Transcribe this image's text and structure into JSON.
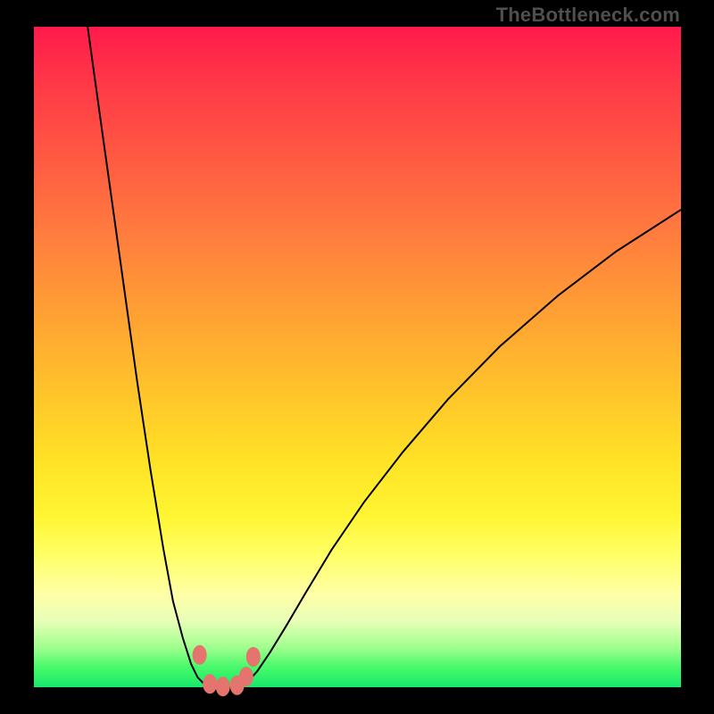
{
  "attribution": "TheBottleneck.com",
  "colors": {
    "top": "#ff1a4b",
    "mid": "#ffe326",
    "bottom": "#17e86a",
    "curve": "#000000",
    "markers": "#e4746d",
    "frame": "#000000"
  },
  "chart_data": {
    "type": "line",
    "title": "",
    "xlabel": "",
    "ylabel": "",
    "xlim": [
      0,
      100
    ],
    "ylim": [
      0,
      100
    ],
    "annotations": [],
    "series": [
      {
        "name": "left-branch",
        "x": [
          8.3,
          10,
          12,
          14,
          16,
          18,
          20,
          21.5,
          23,
          24.3,
          25.3,
          26.2,
          26.8
        ],
        "y": [
          100,
          88,
          74,
          60,
          46,
          33,
          21,
          13,
          7.5,
          3.5,
          1.5,
          0.6,
          0.2
        ]
      },
      {
        "name": "floor",
        "x": [
          26.8,
          28,
          29.5,
          31,
          32.3,
          33.1
        ],
        "y": [
          0.2,
          0.0,
          0.0,
          0.0,
          0.3,
          0.9
        ]
      },
      {
        "name": "right-branch",
        "x": [
          33.1,
          34.5,
          36.5,
          39,
          42,
          46,
          51,
          57,
          64,
          72,
          81,
          90,
          100
        ],
        "y": [
          0.9,
          2.4,
          5.3,
          9.3,
          14.3,
          20.8,
          28,
          35.6,
          43.6,
          51.6,
          59.3,
          66,
          72.3
        ]
      }
    ],
    "markers": [
      {
        "x": 25.6,
        "y": 4.9
      },
      {
        "x": 27.2,
        "y": 0.5
      },
      {
        "x": 29.2,
        "y": 0.1
      },
      {
        "x": 31.4,
        "y": 0.3
      },
      {
        "x": 32.8,
        "y": 1.6
      },
      {
        "x": 33.9,
        "y": 4.6
      }
    ]
  }
}
